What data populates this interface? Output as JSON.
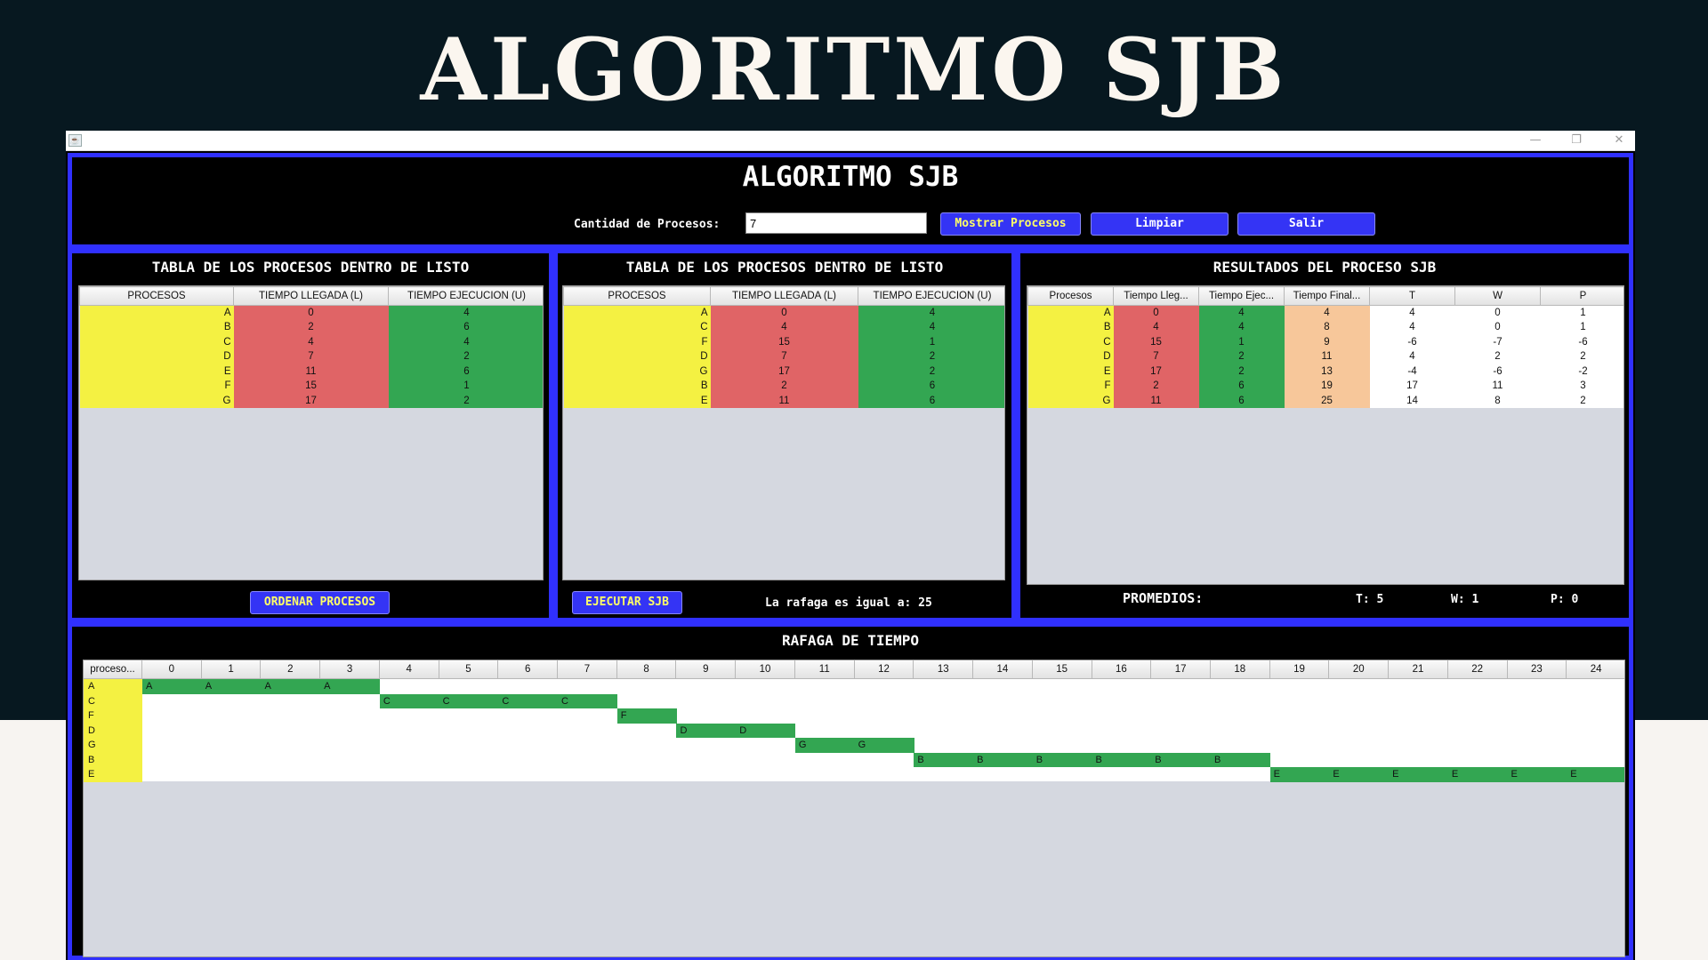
{
  "slide_title": "ALGORITMO SJB",
  "window": {
    "title": "ALGORITMO SJB",
    "icon": "java-cup-icon",
    "controls": {
      "minimize": "—",
      "maximize": "❐",
      "close": "✕"
    },
    "cantidad_label": "Cantidad de Procesos:",
    "cantidad_value": "7",
    "btn_mostrar": "Mostrar Procesos",
    "btn_limpiar": "Limpiar",
    "btn_salir": "Salir"
  },
  "panel1": {
    "title": "TABLA DE LOS PROCESOS DENTRO DE LISTO",
    "headers": [
      "PROCESOS",
      "TIEMPO LLEGADA (L)",
      "TIEMPO EJECUCION (U)"
    ],
    "rows": [
      [
        "A",
        "0",
        "4"
      ],
      [
        "B",
        "2",
        "6"
      ],
      [
        "C",
        "4",
        "4"
      ],
      [
        "D",
        "7",
        "2"
      ],
      [
        "E",
        "11",
        "6"
      ],
      [
        "F",
        "15",
        "1"
      ],
      [
        "G",
        "17",
        "2"
      ]
    ],
    "button": "ORDENAR PROCESOS"
  },
  "panel2": {
    "title": "TABLA DE LOS PROCESOS DENTRO DE LISTO",
    "headers": [
      "PROCESOS",
      "TIEMPO LLEGADA (L)",
      "TIEMPO EJECUCION (U)"
    ],
    "rows": [
      [
        "A",
        "0",
        "4"
      ],
      [
        "C",
        "4",
        "4"
      ],
      [
        "F",
        "15",
        "1"
      ],
      [
        "D",
        "7",
        "2"
      ],
      [
        "G",
        "17",
        "2"
      ],
      [
        "B",
        "2",
        "6"
      ],
      [
        "E",
        "11",
        "6"
      ]
    ],
    "button": "EJECUTAR SJB",
    "rafaga_text": "La rafaga es igual a: 25"
  },
  "panel3": {
    "title": "RESULTADOS DEL PROCESO SJB",
    "headers": [
      "Procesos",
      "Tiempo Lleg...",
      "Tiempo Ejec...",
      "Tiempo Final...",
      "T",
      "W",
      "P"
    ],
    "rows": [
      [
        "A",
        "0",
        "4",
        "4",
        "4",
        "0",
        "1"
      ],
      [
        "B",
        "4",
        "4",
        "8",
        "4",
        "0",
        "1"
      ],
      [
        "C",
        "15",
        "1",
        "9",
        "-6",
        "-7",
        "-6"
      ],
      [
        "D",
        "7",
        "2",
        "11",
        "4",
        "2",
        "2"
      ],
      [
        "E",
        "17",
        "2",
        "13",
        "-4",
        "-6",
        "-2"
      ],
      [
        "F",
        "2",
        "6",
        "19",
        "17",
        "11",
        "3"
      ],
      [
        "G",
        "11",
        "6",
        "25",
        "14",
        "8",
        "2"
      ]
    ],
    "promedios_label": "PROMEDIOS:",
    "prom_t": "T: 5",
    "prom_w": "W: 1",
    "prom_p": "P: 0"
  },
  "gantt": {
    "title": "RAFAGA DE TIEMPO",
    "first_header": "proceso...",
    "time_headers": [
      "0",
      "1",
      "2",
      "3",
      "4",
      "5",
      "6",
      "7",
      "8",
      "9",
      "10",
      "11",
      "12",
      "13",
      "14",
      "15",
      "16",
      "17",
      "18",
      "19",
      "20",
      "21",
      "22",
      "23",
      "24"
    ],
    "rows": [
      {
        "label": "A",
        "start": 0,
        "length": 4
      },
      {
        "label": "C",
        "start": 4,
        "length": 4
      },
      {
        "label": "F",
        "start": 8,
        "length": 1
      },
      {
        "label": "D",
        "start": 9,
        "length": 2
      },
      {
        "label": "G",
        "start": 11,
        "length": 2
      },
      {
        "label": "B",
        "start": 13,
        "length": 6
      },
      {
        "label": "E",
        "start": 19,
        "length": 6
      }
    ]
  }
}
